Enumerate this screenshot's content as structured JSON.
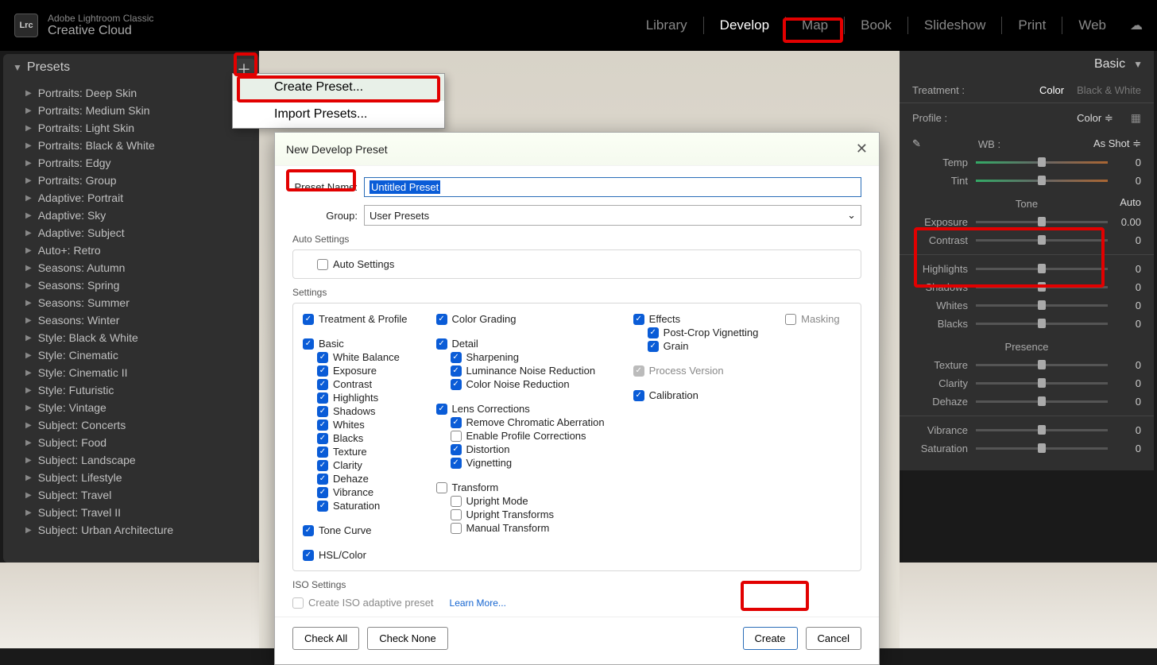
{
  "app": {
    "icon": "Lrc",
    "title": "Adobe Lightroom Classic",
    "subtitle": "Creative Cloud"
  },
  "modules": [
    "Library",
    "Develop",
    "Map",
    "Book",
    "Slideshow",
    "Print",
    "Web"
  ],
  "active_module": "Develop",
  "presets": {
    "title": "Presets",
    "items": [
      "Portraits: Deep Skin",
      "Portraits: Medium Skin",
      "Portraits: Light Skin",
      "Portraits: Black & White",
      "Portraits: Edgy",
      "Portraits: Group",
      "Adaptive: Portrait",
      "Adaptive: Sky",
      "Adaptive: Subject",
      "Auto+: Retro",
      "Seasons: Autumn",
      "Seasons: Spring",
      "Seasons: Summer",
      "Seasons: Winter",
      "Style: Black & White",
      "Style: Cinematic",
      "Style: Cinematic II",
      "Style: Futuristic",
      "Style: Vintage",
      "Subject: Concerts",
      "Subject: Food",
      "Subject: Landscape",
      "Subject: Lifestyle",
      "Subject: Travel",
      "Subject: Travel II",
      "Subject: Urban Architecture"
    ]
  },
  "context_menu": {
    "create": "Create Preset...",
    "import": "Import Presets..."
  },
  "dialog": {
    "title": "New Develop Preset",
    "preset_name_label": "Preset Name:",
    "preset_name_value": "Untitled Preset",
    "group_label": "Group:",
    "group_value": "User Presets",
    "auto_settings_label": "Auto Settings",
    "auto_settings_chk": "Auto Settings",
    "settings_label": "Settings",
    "col1": {
      "treatment": "Treatment & Profile",
      "basic": "Basic",
      "basic_items": [
        "White Balance",
        "Exposure",
        "Contrast",
        "Highlights",
        "Shadows",
        "Whites",
        "Blacks",
        "Texture",
        "Clarity",
        "Dehaze",
        "Vibrance",
        "Saturation"
      ],
      "tone_curve": "Tone Curve",
      "hsl": "HSL/Color"
    },
    "col2": {
      "color_grading": "Color Grading",
      "detail": "Detail",
      "detail_items": [
        "Sharpening",
        "Luminance Noise Reduction",
        "Color Noise Reduction"
      ],
      "lens": "Lens Corrections",
      "lens_items": [
        {
          "label": "Remove Chromatic Aberration",
          "on": true
        },
        {
          "label": "Enable Profile Corrections",
          "on": false
        },
        {
          "label": "Distortion",
          "on": true
        },
        {
          "label": "Vignetting",
          "on": true
        }
      ],
      "transform": "Transform",
      "transform_items": [
        "Upright Mode",
        "Upright Transforms",
        "Manual Transform"
      ]
    },
    "col3": {
      "effects": "Effects",
      "effects_items": [
        "Post-Crop Vignetting",
        "Grain"
      ],
      "masking": "Masking",
      "process": "Process Version",
      "calibration": "Calibration"
    },
    "iso_label": "ISO Settings",
    "iso_chk": "Create ISO adaptive preset",
    "learn_more": "Learn More...",
    "check_all": "Check All",
    "check_none": "Check None",
    "create_btn": "Create",
    "cancel_btn": "Cancel"
  },
  "basic_panel": {
    "title": "Basic",
    "treatment_label": "Treatment :",
    "treatment_color": "Color",
    "treatment_bw": "Black & White",
    "profile_label": "Profile :",
    "profile_value": "Color",
    "wb_label": "WB :",
    "wb_value": "As Shot",
    "temp": "Temp",
    "temp_val": "0",
    "tint": "Tint",
    "tint_val": "0",
    "tone_title": "Tone",
    "auto": "Auto",
    "exposure": "Exposure",
    "exposure_val": "0.00",
    "contrast": "Contrast",
    "contrast_val": "0",
    "highlights": "Highlights",
    "highlights_val": "0",
    "shadows": "Shadows",
    "shadows_val": "0",
    "whites": "Whites",
    "whites_val": "0",
    "blacks": "Blacks",
    "blacks_val": "0",
    "presence_title": "Presence",
    "texture": "Texture",
    "texture_val": "0",
    "clarity": "Clarity",
    "clarity_val": "0",
    "dehaze": "Dehaze",
    "dehaze_val": "0",
    "vibrance": "Vibrance",
    "vibrance_val": "0",
    "saturation": "Saturation",
    "saturation_val": "0"
  }
}
